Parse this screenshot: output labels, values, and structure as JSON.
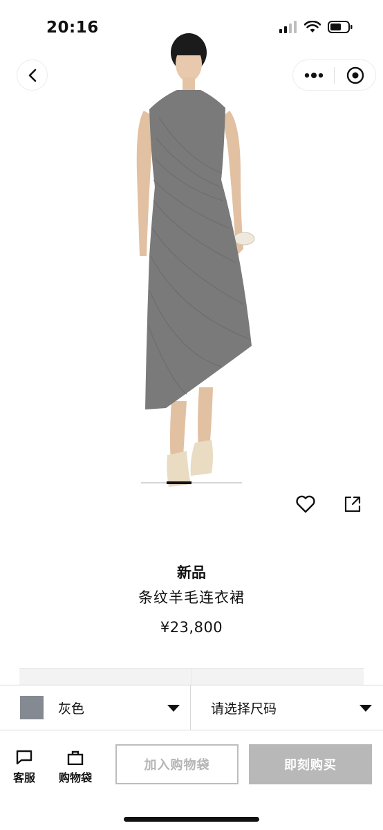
{
  "status_bar": {
    "time": "20:16"
  },
  "nav": {
    "back_icon": "chevron-left-icon",
    "more_icon": "more-dots-icon",
    "close_icon": "target-close-icon"
  },
  "product": {
    "badge": "新品",
    "name": "条纹羊毛连衣裙",
    "price": "¥23,800",
    "dress_color": "#7a7a7a"
  },
  "actions": {
    "favorite_icon": "heart-icon",
    "share_icon": "share-icon"
  },
  "selectors": {
    "color": {
      "label": "灰色",
      "swatch": "#858991"
    },
    "size": {
      "placeholder": "请选择尺码"
    }
  },
  "bottom_bar": {
    "service_label": "客服",
    "bag_label": "购物袋",
    "add_to_bag": "加入购物袋",
    "buy_now": "即刻购买"
  },
  "gallery": {
    "current_page": 1
  }
}
